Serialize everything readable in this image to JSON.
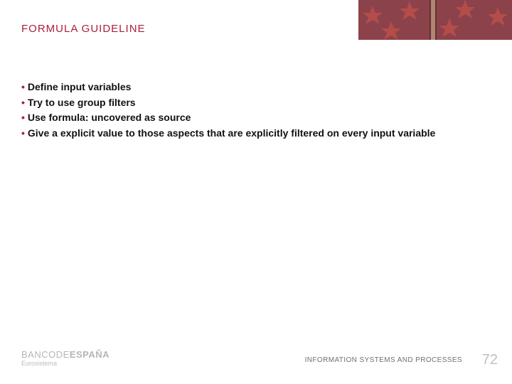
{
  "title": "FORMULA GUIDELINE",
  "bullets": [
    "Define input variables",
    "Try to use group filters",
    "Use formula: uncovered as source",
    "Give a explicit value to those aspects that are explicitly filtered on every input variable"
  ],
  "brand": {
    "top_light": "BANCODE",
    "top_bold": "ESPAÑA",
    "sub": "Eurosistema"
  },
  "footer_label": "INFORMATION SYSTEMS AND PROCESSES",
  "page_number": "72"
}
